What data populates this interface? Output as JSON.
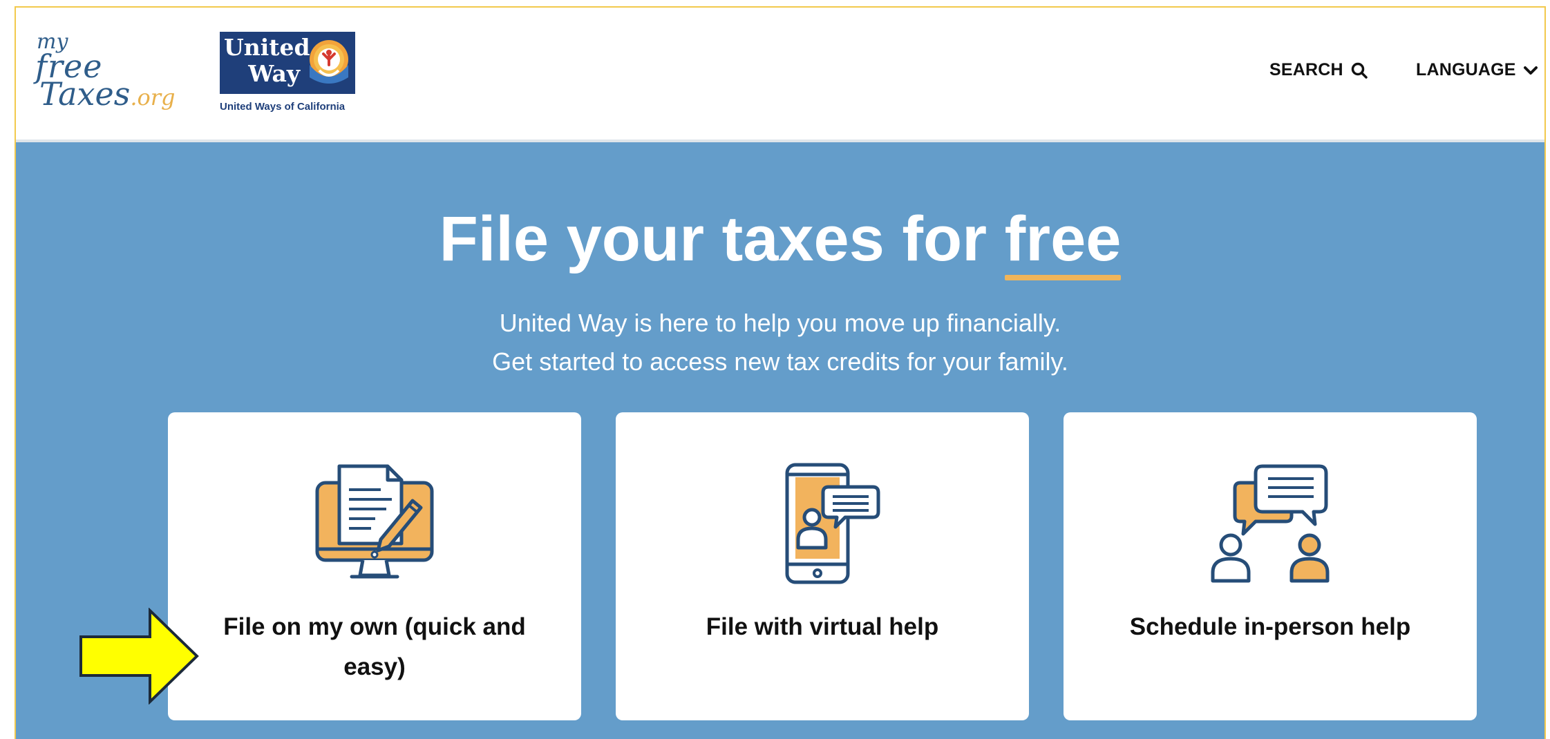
{
  "header": {
    "logo": {
      "my": "my",
      "free": "free",
      "taxes": "Taxes",
      "org": ".org"
    },
    "partner_logo": {
      "line1": "United",
      "line2": "Way",
      "tagline": "United Ways of California"
    },
    "nav": {
      "search_label": "SEARCH",
      "search_icon": "search-icon",
      "language_label": "LANGUAGE",
      "language_icon": "chevron-down-icon"
    }
  },
  "hero": {
    "title_lead": "File your taxes for ",
    "title_emphasis": "free",
    "subtitle_line1": "United Way is here to help you move up financially.",
    "subtitle_line2": "Get started to access new tax credits for your family."
  },
  "cards": [
    {
      "label": "File on my own (quick and easy)",
      "icon": "document-computer-icon"
    },
    {
      "label": "File with virtual help",
      "icon": "tablet-chat-icon"
    },
    {
      "label": "Schedule in-person help",
      "icon": "people-conversation-icon"
    }
  ],
  "annotation": {
    "icon": "pointer-arrow-icon"
  },
  "colors": {
    "hero_bg": "#649dca",
    "accent": "#f0b55a",
    "brand_blue": "#1f3f7a",
    "icon_stroke": "#264d78",
    "frame_border": "#f2c94c",
    "arrow_fill": "#ffff00"
  }
}
